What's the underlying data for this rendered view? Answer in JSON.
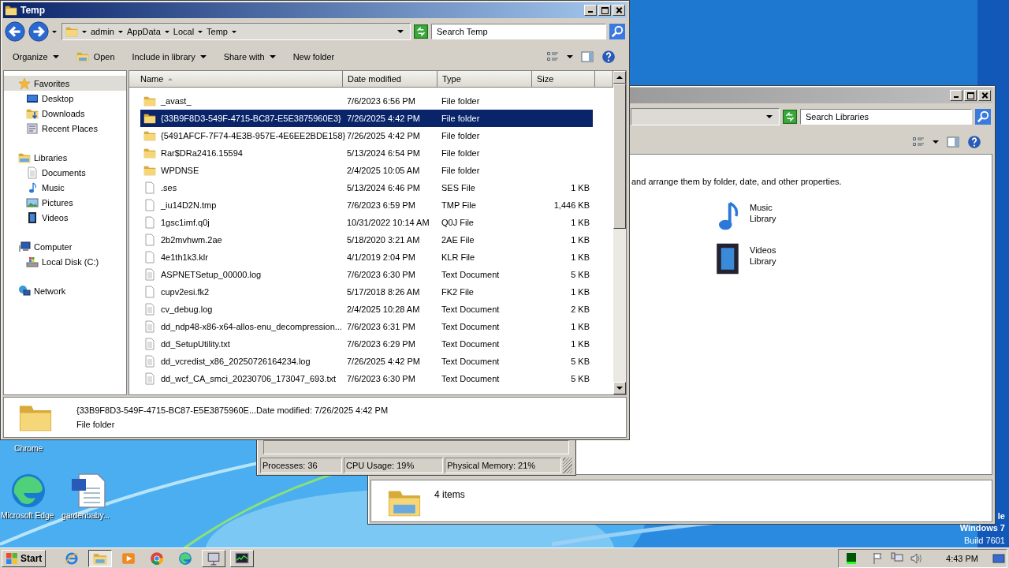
{
  "temp_window": {
    "title": "Temp",
    "breadcrumb": [
      "admin",
      "AppData",
      "Local",
      "Temp"
    ],
    "search": {
      "placeholder": "Search Temp"
    },
    "toolbar": [
      {
        "label": "Organize",
        "kind": "menu",
        "dropdown": true
      },
      {
        "label": "Open",
        "kind": "open",
        "dropdown": false
      },
      {
        "label": "Include in library",
        "kind": "menu",
        "dropdown": true
      },
      {
        "label": "Share with",
        "kind": "menu",
        "dropdown": true
      },
      {
        "label": "New folder",
        "kind": "menu",
        "dropdown": false
      }
    ],
    "nav": [
      {
        "label": "Favorites",
        "kind": "star",
        "selected": true,
        "children": [
          {
            "label": "Desktop",
            "kind": "desktop",
            "selected": false
          },
          {
            "label": "Downloads",
            "kind": "downloads",
            "selected": false
          },
          {
            "label": "Recent Places",
            "kind": "recent",
            "selected": false
          }
        ]
      },
      {
        "label": "Libraries",
        "kind": "libraries",
        "selected": false,
        "children": [
          {
            "label": "Documents",
            "kind": "documents",
            "selected": false
          },
          {
            "label": "Music",
            "kind": "music",
            "selected": false
          },
          {
            "label": "Pictures",
            "kind": "pictures",
            "selected": false
          },
          {
            "label": "Videos",
            "kind": "videos",
            "selected": false
          }
        ]
      },
      {
        "label": "Computer",
        "kind": "computer",
        "selected": false,
        "children": [
          {
            "label": "Local Disk (C:)",
            "kind": "disk",
            "selected": false
          }
        ]
      },
      {
        "label": "Network",
        "kind": "network",
        "selected": false
      }
    ],
    "columns": [
      {
        "label": "Name",
        "sorted": true
      },
      {
        "label": "Date modified",
        "sorted": false
      },
      {
        "label": "Type",
        "sorted": false
      },
      {
        "label": "Size",
        "sorted": false
      }
    ],
    "rows": [
      {
        "name": "_avast_",
        "date": "7/6/2023 6:56 PM",
        "type": "File folder",
        "kind": "folder",
        "selected": false
      },
      {
        "name": "{33B9F8D3-549F-4715-BC87-E5E3875960E3}",
        "date": "7/26/2025 4:42 PM",
        "type": "File folder",
        "kind": "folder",
        "selected": true
      },
      {
        "name": "{5491AFCF-7F74-4E3B-957E-4E6EE2BDE158}",
        "date": "7/26/2025 4:42 PM",
        "type": "File folder",
        "kind": "folder",
        "selected": false
      },
      {
        "name": "Rar$DRa2416.15594",
        "date": "5/13/2024 6:54 PM",
        "type": "File folder",
        "kind": "folder",
        "selected": false
      },
      {
        "name": "WPDNSE",
        "date": "2/4/2025 10:05 AM",
        "type": "File folder",
        "kind": "folder",
        "selected": false
      },
      {
        "name": ".ses",
        "date": "5/13/2024 6:46 PM",
        "type": "SES File",
        "size": "1 KB",
        "kind": "file",
        "selected": false
      },
      {
        "name": "_iu14D2N.tmp",
        "date": "7/6/2023 6:59 PM",
        "type": "TMP File",
        "size": "1,446 KB",
        "kind": "file",
        "selected": false
      },
      {
        "name": "1gsc1imf.q0j",
        "date": "10/31/2022 10:14 AM",
        "type": "Q0J File",
        "size": "1 KB",
        "kind": "file",
        "selected": false
      },
      {
        "name": "2b2mvhwm.2ae",
        "date": "5/18/2020 3:21 AM",
        "type": "2AE File",
        "size": "1 KB",
        "kind": "file",
        "selected": false
      },
      {
        "name": "4e1th1k3.klr",
        "date": "4/1/2019 2:04 PM",
        "type": "KLR File",
        "size": "1 KB",
        "kind": "file",
        "selected": false
      },
      {
        "name": "ASPNETSetup_00000.log",
        "date": "7/6/2023 6:30 PM",
        "type": "Text Document",
        "size": "5 KB",
        "kind": "text",
        "selected": false
      },
      {
        "name": "cupv2esi.fk2",
        "date": "5/17/2018 8:26 AM",
        "type": "FK2 File",
        "size": "1 KB",
        "kind": "file",
        "selected": false
      },
      {
        "name": "cv_debug.log",
        "date": "2/4/2025 10:28 AM",
        "type": "Text Document",
        "size": "2 KB",
        "kind": "text",
        "selected": false
      },
      {
        "name": "dd_ndp48-x86-x64-allos-enu_decompression...",
        "date": "7/6/2023 6:31 PM",
        "type": "Text Document",
        "size": "1 KB",
        "kind": "text",
        "selected": false
      },
      {
        "name": "dd_SetupUtility.txt",
        "date": "7/6/2023 6:29 PM",
        "type": "Text Document",
        "size": "1 KB",
        "kind": "text",
        "selected": false
      },
      {
        "name": "dd_vcredist_x86_20250726164234.log",
        "date": "7/26/2025 4:42 PM",
        "type": "Text Document",
        "size": "5 KB",
        "kind": "text",
        "selected": false
      },
      {
        "name": "dd_wcf_CA_smci_20230706_173047_693.txt",
        "date": "7/6/2023 6:30 PM",
        "type": "Text Document",
        "size": "5 KB",
        "kind": "text",
        "selected": false
      }
    ],
    "details": {
      "name": "{33B9F8D3-549F-4715-BC87-E5E3875960E...",
      "modified": "Date modified: 7/26/2025 4:42 PM",
      "type": "File folder"
    }
  },
  "libraries_window": {
    "search": {
      "placeholder": "Search Libraries"
    },
    "description": "and arrange them by folder, date, and other properties.",
    "libraries": [
      {
        "label": "Music Library",
        "kind": "music"
      },
      {
        "label": "Videos Library",
        "kind": "videos"
      }
    ],
    "details": "4 items"
  },
  "task_manager": {
    "status": [
      "Processes: 36",
      "CPU Usage: 19%",
      "Physical Memory: 21%"
    ]
  },
  "desktop": {
    "icons": [
      {
        "label": "Chrome",
        "kind": "hidden"
      },
      {
        "label": "Microsoft Edge",
        "kind": "edge"
      },
      {
        "label": "gardenbaby...",
        "kind": "word"
      }
    ],
    "watermark_lines": [
      "le",
      "Windows 7",
      "Build 7601"
    ]
  },
  "taskbar": {
    "start": "Start",
    "apps": [
      {
        "kind": "ie",
        "active": false,
        "running": false
      },
      {
        "kind": "explorer",
        "active": true,
        "running": true
      },
      {
        "kind": "media",
        "active": false,
        "running": false
      },
      {
        "kind": "chrome",
        "active": false,
        "running": false
      },
      {
        "kind": "edge",
        "active": false,
        "running": false
      },
      {
        "kind": "app",
        "active": false,
        "running": true
      },
      {
        "kind": "taskmgr",
        "active": false,
        "running": true
      }
    ],
    "clock": "4:43 PM"
  }
}
